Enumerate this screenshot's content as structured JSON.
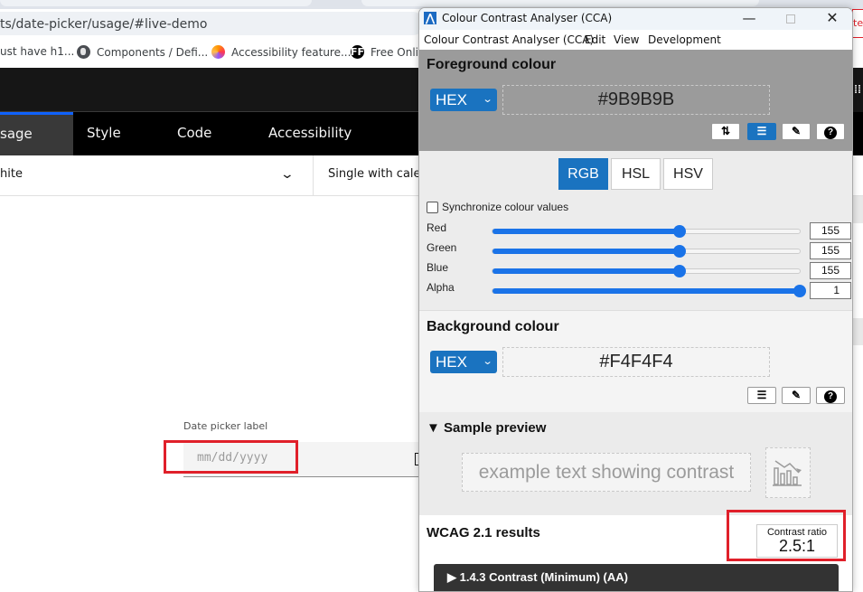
{
  "browser": {
    "url": "ts/date-picker/usage/#live-demo",
    "bookmarks": [
      {
        "label": "ust have h1...",
        "icon": "none"
      },
      {
        "label": "Components / Defi...",
        "icon": "globe-icon"
      },
      {
        "label": "Accessibility feature...",
        "icon": "firefox-icon"
      },
      {
        "label": "Free Onlin",
        "icon": "ff-icon"
      }
    ]
  },
  "page": {
    "tabs": [
      {
        "label": "sage",
        "active": true
      },
      {
        "label": "Style",
        "active": false
      },
      {
        "label": "Code",
        "active": false
      },
      {
        "label": "Accessibility",
        "active": false
      }
    ],
    "theme_dropdown": {
      "value": "hite",
      "chevron": "⌄"
    },
    "variant_dropdown": {
      "value": "Single with cale"
    },
    "date_picker": {
      "label": "Date picker label",
      "placeholder": "mm/dd/yyyy"
    }
  },
  "cca": {
    "window_title": "Colour Contrast Analyser (CCA)",
    "controls": {
      "minimize": "—",
      "close": "✕"
    },
    "menu": [
      "Colour Contrast Analyser (CCA)",
      "Edit",
      "View",
      "Development"
    ],
    "foreground": {
      "title": "Foreground colour",
      "format": "HEX",
      "value": "#9B9B9B",
      "buttons": [
        {
          "name": "swap-icon",
          "glyph": "⇅",
          "active": false
        },
        {
          "name": "sliders-icon",
          "glyph": "☰",
          "active": true
        },
        {
          "name": "eyedropper-icon",
          "glyph": "✎",
          "active": false
        },
        {
          "name": "help-icon",
          "glyph": "?",
          "active": false
        }
      ]
    },
    "model_tabs": [
      {
        "label": "RGB",
        "active": true
      },
      {
        "label": "HSL",
        "active": false
      },
      {
        "label": "HSV",
        "active": false
      }
    ],
    "sync_label": "Synchronize colour values",
    "sync_checked": false,
    "sliders": [
      {
        "label": "Red",
        "value": "155",
        "fraction": 0.608
      },
      {
        "label": "Green",
        "value": "155",
        "fraction": 0.608
      },
      {
        "label": "Blue",
        "value": "155",
        "fraction": 0.608
      },
      {
        "label": "Alpha",
        "value": "1",
        "fraction": 1.0
      }
    ],
    "background": {
      "title": "Background colour",
      "format": "HEX",
      "value": "#F4F4F4",
      "buttons": [
        {
          "name": "sliders-icon",
          "glyph": "☰"
        },
        {
          "name": "eyedropper-icon",
          "glyph": "✎"
        },
        {
          "name": "help-icon",
          "glyph": "?"
        }
      ]
    },
    "sample": {
      "title": "▼ Sample preview",
      "text": "example text showing contrast"
    },
    "wcag": {
      "title": "WCAG 2.1 results",
      "ratio_label": "Contrast ratio",
      "ratio_value": "2.5:1",
      "criterion": "▶  1.4.3 Contrast (Minimum) (AA)"
    },
    "colors": {
      "accent": "#1A73C0",
      "slider": "#1A73E8",
      "foreground": "#9B9B9B",
      "background": "#F4F4F4",
      "highlight": "#E0202A"
    }
  }
}
